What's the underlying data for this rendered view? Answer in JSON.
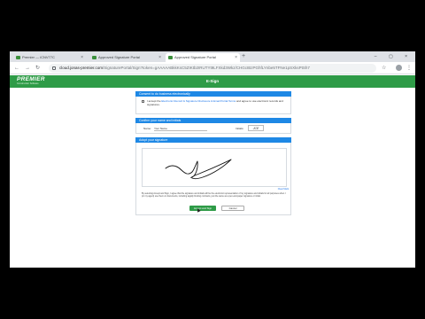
{
  "browser": {
    "tabs": [
      {
        "label": "Premier — iCNV77C",
        "active": false
      },
      {
        "label": "Approved Signature Portal",
        "active": false
      },
      {
        "label": "Approved Signature Portal",
        "active": true
      }
    ],
    "url_host": "cloud.jonas-premier.com",
    "url_path": "/SignaturePortal/Sign?token=gAAAAABkkKsC5ZIKtb2IRUTYt9LFXkd3Wkz/CHGcIBzPGhfLYnbe5TFNe1pSXksPtSh7"
  },
  "site": {
    "logo_text": "PREMIER",
    "logo_sub": "Construction Software",
    "header_title": "E-Sign",
    "brand_color": "#2e9b47",
    "section_color": "#1e88e5"
  },
  "consent": {
    "heading": "Consent to do business electronically",
    "text_prefix": "I accept the",
    "link_text": "Electronic Record & Signature Disclosure & Email Portal Terms",
    "text_suffix": "and agree to use electronic records and signatures."
  },
  "confirm": {
    "heading": "Confirm your name and initials",
    "name_label": "Name:",
    "name_value": "Your Name",
    "initials_label": "Initials:",
    "initials_value": "JCE"
  },
  "adopt": {
    "heading": "Adopt your signature",
    "clear_label": "Clear Mark",
    "legal_text": "By selecting Accept and Sign, I agree that the signature and initials will be the electronic representation of my signature and initials for all purposes when I (or my agent) use them on documents, including legally binding contracts, just the same as a pen-and-paper signature or initial.",
    "accept_label": "Accept and Sign",
    "cancel_label": "Cancel"
  }
}
